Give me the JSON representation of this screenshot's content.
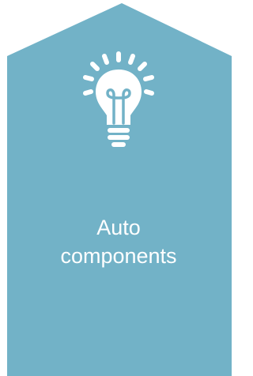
{
  "card": {
    "label_line1": "Auto",
    "label_line2": "components",
    "icon": "lightbulb-icon",
    "fill_color": "#72b2c7",
    "text_color": "#ffffff"
  }
}
